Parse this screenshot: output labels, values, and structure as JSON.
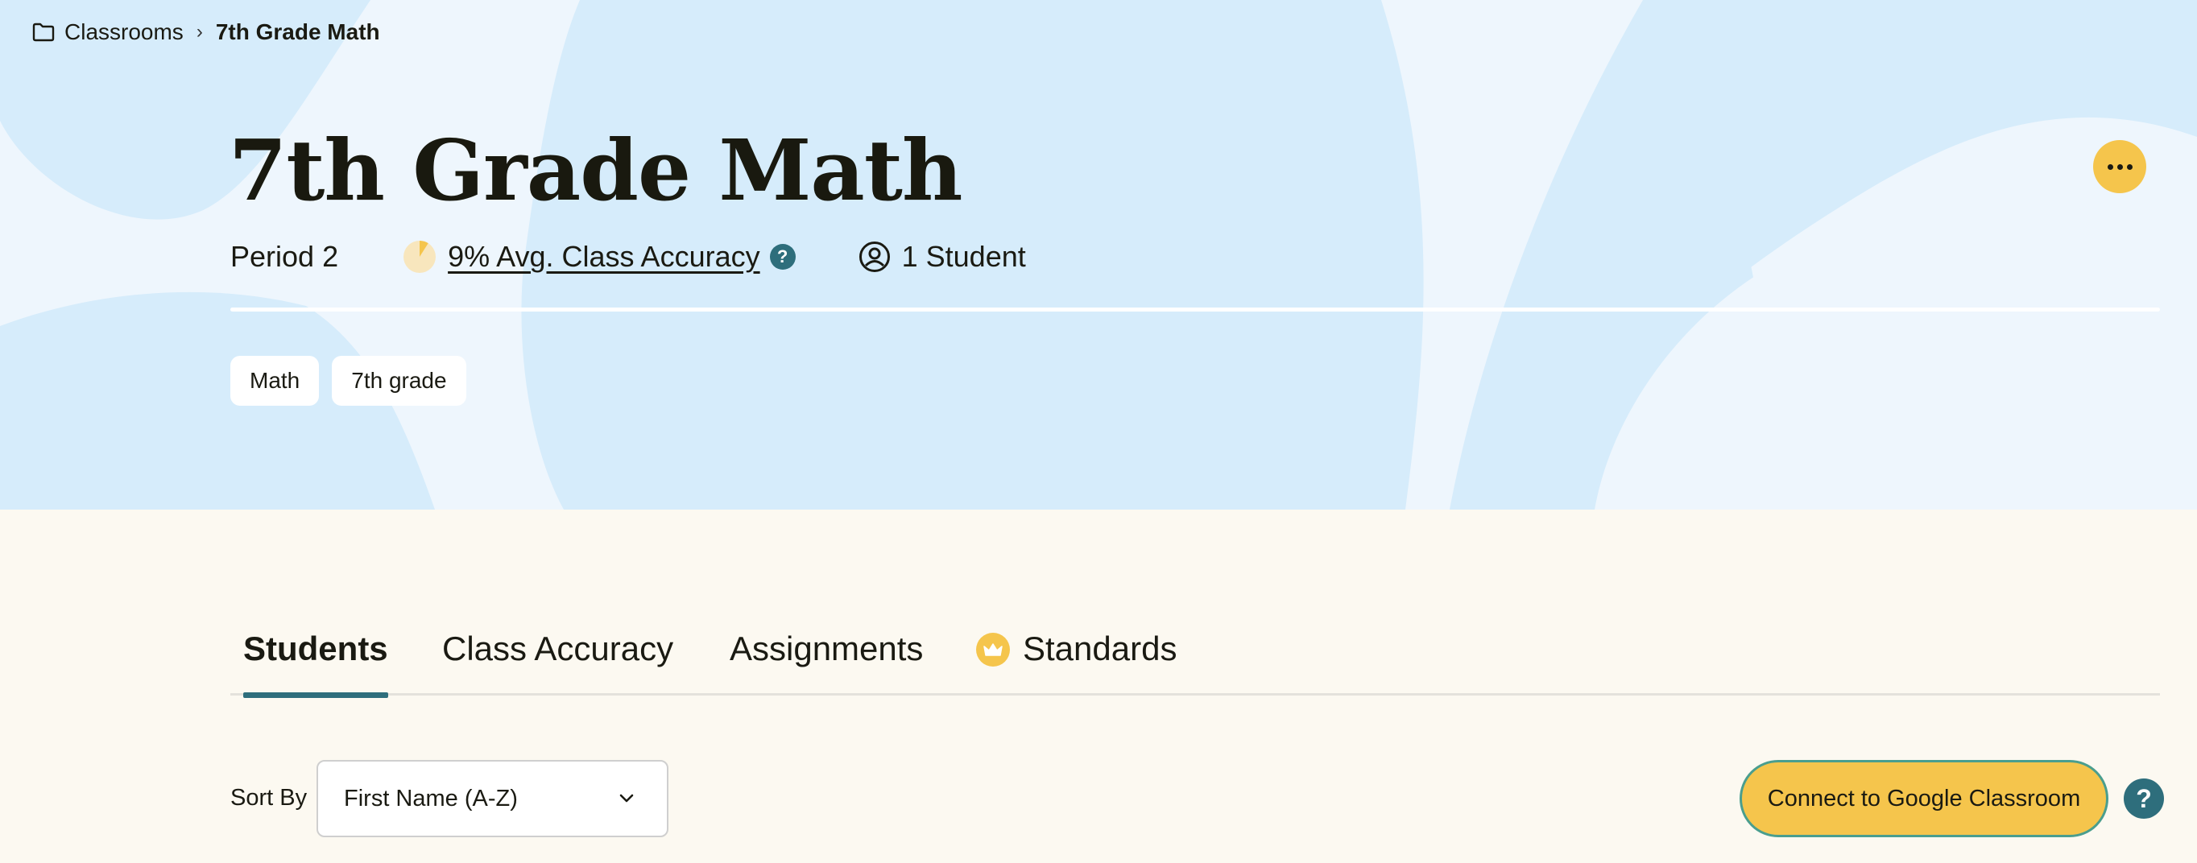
{
  "breadcrumb": {
    "parent": "Classrooms",
    "current": "7th Grade Math"
  },
  "classroom": {
    "title": "7th Grade Math",
    "period": "Period 2",
    "avg_accuracy_label": "9% Avg. Class Accuracy",
    "avg_accuracy_percent": 9,
    "accuracy_help": "?",
    "student_count_label": "1 Student",
    "tags": [
      "Math",
      "7th grade"
    ]
  },
  "tabs": [
    {
      "label": "Students",
      "active": true
    },
    {
      "label": "Class Accuracy",
      "active": false
    },
    {
      "label": "Assignments",
      "active": false
    },
    {
      "label": "Standards",
      "active": false,
      "icon": "crown-icon"
    }
  ],
  "sort": {
    "label": "Sort By",
    "selected": "First Name (A-Z)"
  },
  "actions": {
    "google_classroom": "Connect to Google Classroom",
    "help": "?"
  },
  "colors": {
    "hero_bg": "#eef6fd",
    "hero_shape": "#d6ecfb",
    "page_bg": "#fcf9f1",
    "accent_yellow": "#f5c54c",
    "accent_teal": "#2e6e7c",
    "button_border": "#4a9e8e"
  }
}
